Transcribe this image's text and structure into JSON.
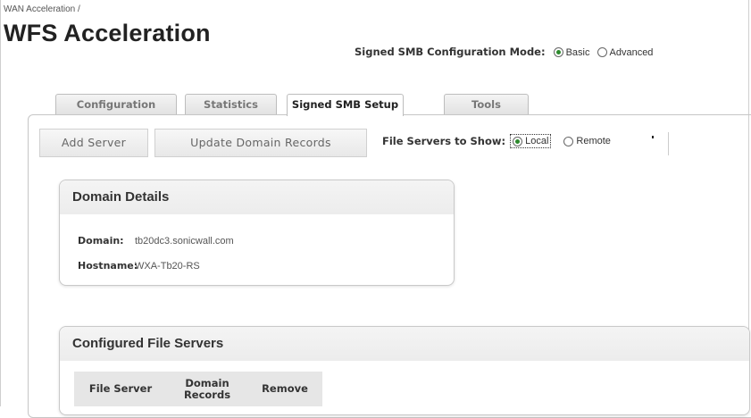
{
  "breadcrumb": "WAN Acceleration /",
  "title": "WFS Acceleration",
  "mode": {
    "label": "Signed SMB Configuration Mode:",
    "options": [
      {
        "label": "Basic",
        "checked": true
      },
      {
        "label": "Advanced",
        "checked": false
      }
    ]
  },
  "tabs": [
    {
      "label": "Configuration",
      "active": false
    },
    {
      "label": "Statistics",
      "active": false
    },
    {
      "label": "Signed SMB Setup",
      "active": true
    },
    {
      "label": "Tools",
      "active": false
    }
  ],
  "toolbar": {
    "add_server": "Add Server",
    "update_domain_records": "Update Domain Records"
  },
  "file_servers_filter": {
    "label": "File Servers to Show:",
    "options": [
      {
        "label": "Local",
        "checked": true
      },
      {
        "label": "Remote",
        "checked": false
      }
    ]
  },
  "domain_details": {
    "heading": "Domain Details",
    "domain_label": "Domain:",
    "domain_value": "tb20dc3.sonicwall.com",
    "hostname_label": "Hostname:",
    "hostname_value": "WXA-Tb20-RS"
  },
  "configured_servers": {
    "heading": "Configured File Servers",
    "columns": [
      "File Server",
      "Domain Records",
      "Remove"
    ]
  },
  "colors": {
    "radio_checked": "#2d8a2d",
    "panel_border": "#c6c6c6",
    "header_bg": "#e6e6e6"
  }
}
